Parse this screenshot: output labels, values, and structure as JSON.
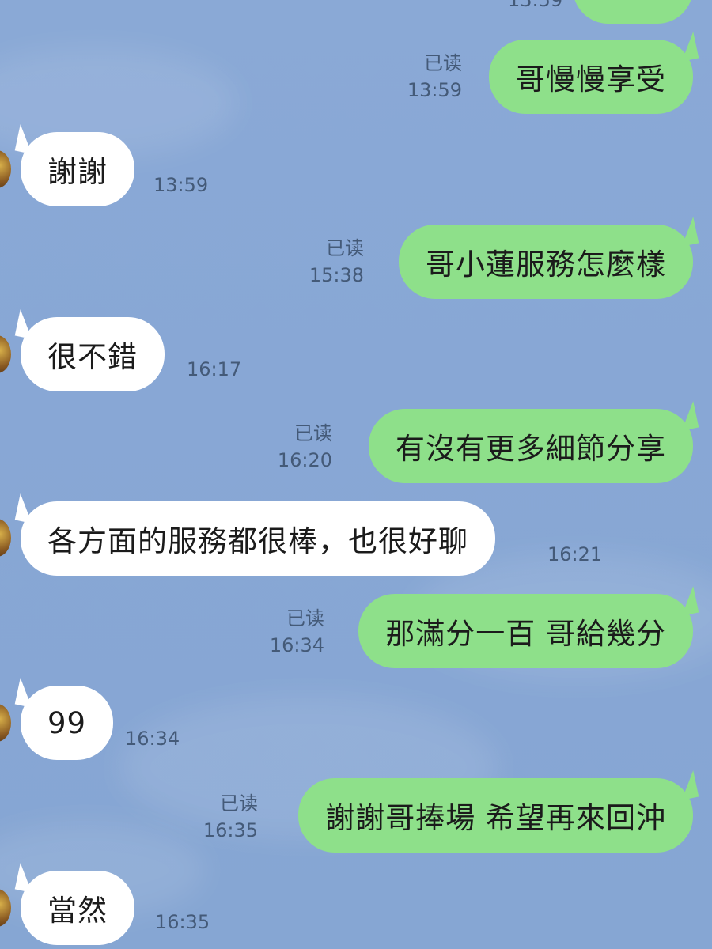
{
  "top_partial": {
    "time": "13:59"
  },
  "messages": [
    {
      "side": "sent",
      "text": "哥慢慢享受",
      "read": "已读",
      "time": "13:59"
    },
    {
      "side": "recv",
      "text": "謝謝",
      "time": "13:59"
    },
    {
      "side": "sent",
      "text": "哥小蓮服務怎麼樣",
      "read": "已读",
      "time": "15:38"
    },
    {
      "side": "recv",
      "text": "很不錯",
      "time": "16:17"
    },
    {
      "side": "sent",
      "text": "有沒有更多細節分享",
      "read": "已读",
      "time": "16:20"
    },
    {
      "side": "recv",
      "text": "各方面的服務都很棒，也很好聊",
      "time": "16:21"
    },
    {
      "side": "sent",
      "text": "那滿分一百 哥給幾分",
      "read": "已读",
      "time": "16:34"
    },
    {
      "side": "recv",
      "text": "99",
      "time": "16:34"
    },
    {
      "side": "sent",
      "text": "謝謝哥捧場 希望再來回沖",
      "read": "已读",
      "time": "16:35"
    },
    {
      "side": "recv",
      "text": "當然",
      "time": "16:35"
    }
  ],
  "colors": {
    "background": "#88a7d5",
    "sent_bubble": "#8ee08a",
    "recv_bubble": "#ffffff",
    "meta_text": "#445a78"
  }
}
